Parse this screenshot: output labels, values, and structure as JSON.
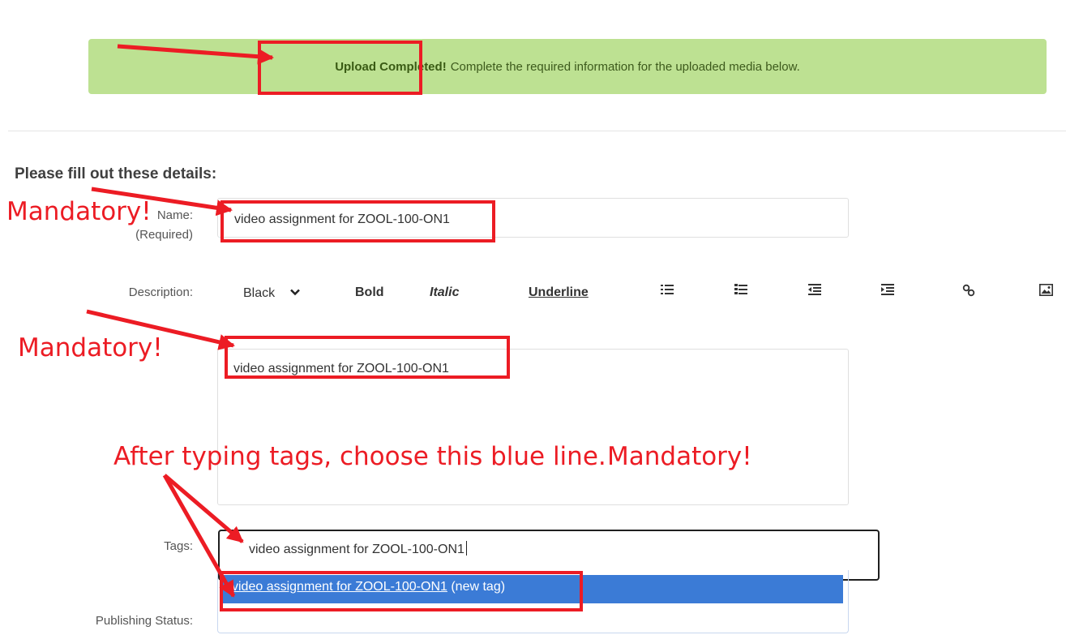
{
  "banner": {
    "strong": "Upload Completed!",
    "text": "Complete the required information for the uploaded media below."
  },
  "form": {
    "heading": "Please fill out these details:",
    "name_label": "Name:",
    "name_required": "(Required)",
    "name_value": "video assignment for ZOOL-100-ON1",
    "description_label": "Description:",
    "description_value": "video assignment for ZOOL-100-ON1",
    "tags_label": "Tags:",
    "tags_value": "video assignment for ZOOL-100-ON1",
    "publishing_label": "Publishing Status:"
  },
  "toolbar": {
    "color": "Black",
    "bold": "Bold",
    "italic": "Italic",
    "underline": "Underline",
    "icons": [
      "unordered-list-icon",
      "ordered-list-icon",
      "outdent-icon",
      "indent-icon",
      "link-icon",
      "image-icon"
    ]
  },
  "tag_suggestion": {
    "link": "video assignment for ZOOL-100-ON1",
    "suffix": "(new tag)"
  },
  "annotations": {
    "mandatory_1": "Mandatory!",
    "mandatory_2": "Mandatory!",
    "instruction": "After typing tags, choose this blue line.",
    "mandatory_3": "Mandatory!"
  },
  "colors": {
    "banner_bg": "#bde192",
    "annotation_red": "#ec1c24",
    "suggestion_blue": "#3b7bd6"
  }
}
